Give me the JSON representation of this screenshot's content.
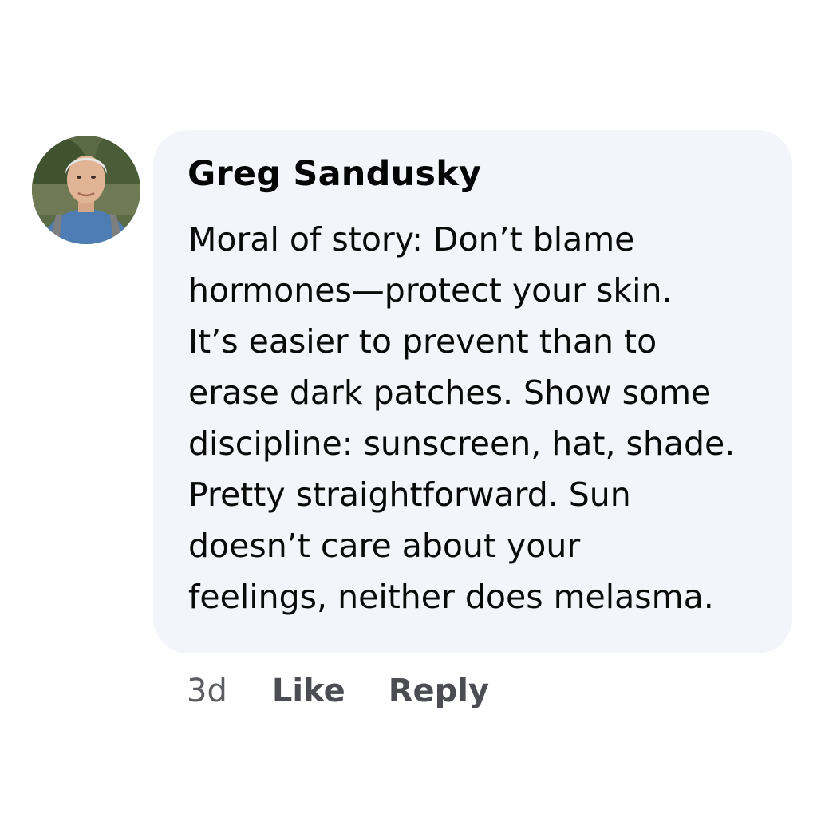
{
  "comment": {
    "author": "Greg Sandusky",
    "lines": [
      "Moral of story: Don’t blame",
      "hormones—protect your skin.",
      "It’s easier to prevent than to",
      "erase dark patches. Show some",
      "discipline: sunscreen, hat, shade.",
      "Pretty straightforward. Sun",
      "doesn’t care about your",
      "feelings, neither does melasma."
    ],
    "timestamp": "3d",
    "like_label": "Like",
    "reply_label": "Reply"
  },
  "colors": {
    "bubble": "#f4f5fa",
    "text": "#050505",
    "meta": "#5b5d61"
  },
  "icons": {
    "avatar": "profile-photo"
  }
}
